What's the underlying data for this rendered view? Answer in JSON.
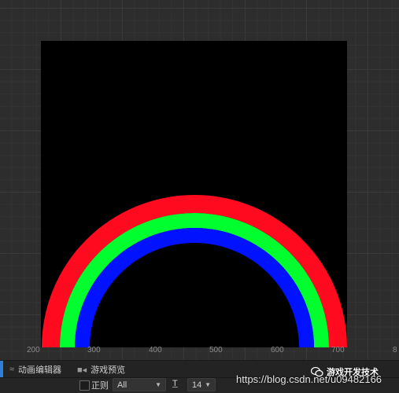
{
  "ruler": {
    "labels": [
      "200",
      "300",
      "400",
      "500",
      "600",
      "700",
      "8"
    ]
  },
  "rainbow": {
    "colors": [
      "#ff0a1e",
      "#00ff2e",
      "#0012ff"
    ],
    "background": "#000000"
  },
  "panel_tabs": {
    "animation_editor": "动画编辑器",
    "game_preview": "游戏预览"
  },
  "toolbar": {
    "regex_label": "正则",
    "filter_value": "All",
    "font_size_value": "14",
    "font_icon": "T"
  },
  "watermark": {
    "url": "https://blog.csdn.net/u09482166",
    "badge": "游戏开发技术"
  },
  "colors": {
    "accent": "#2f7fd6"
  }
}
